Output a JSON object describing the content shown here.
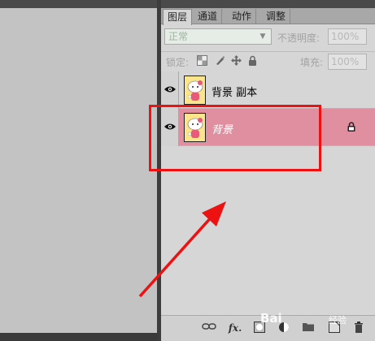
{
  "tabs": [
    {
      "label": "图层",
      "active": true
    },
    {
      "label": "通道",
      "active": false
    },
    {
      "label": "动作",
      "active": false
    },
    {
      "label": "调整",
      "active": false
    }
  ],
  "blend": {
    "mode": "正常"
  },
  "opacity": {
    "label": "不透明度:",
    "value": "100%"
  },
  "lock": {
    "label": "锁定:",
    "icons": [
      "lock-transparent-icon",
      "lock-pixels-icon",
      "lock-position-icon",
      "lock-all-icon"
    ]
  },
  "fill": {
    "label": "填充:",
    "value": "100%"
  },
  "layers": [
    {
      "name": "背景 副本",
      "selected": false,
      "locked": false,
      "visible": true
    },
    {
      "name": "背景",
      "selected": true,
      "locked": true,
      "visible": true
    }
  ],
  "bottom_icons": [
    "link-icon",
    "fx-icon",
    "mask-icon",
    "adjustment-icon",
    "folder-icon",
    "new-layer-icon",
    "trash-icon"
  ],
  "watermark": {
    "text": "Bai",
    "sub": "经验"
  },
  "colors": {
    "selected_layer": "#df8fa0",
    "annotation": "#ee1111"
  }
}
